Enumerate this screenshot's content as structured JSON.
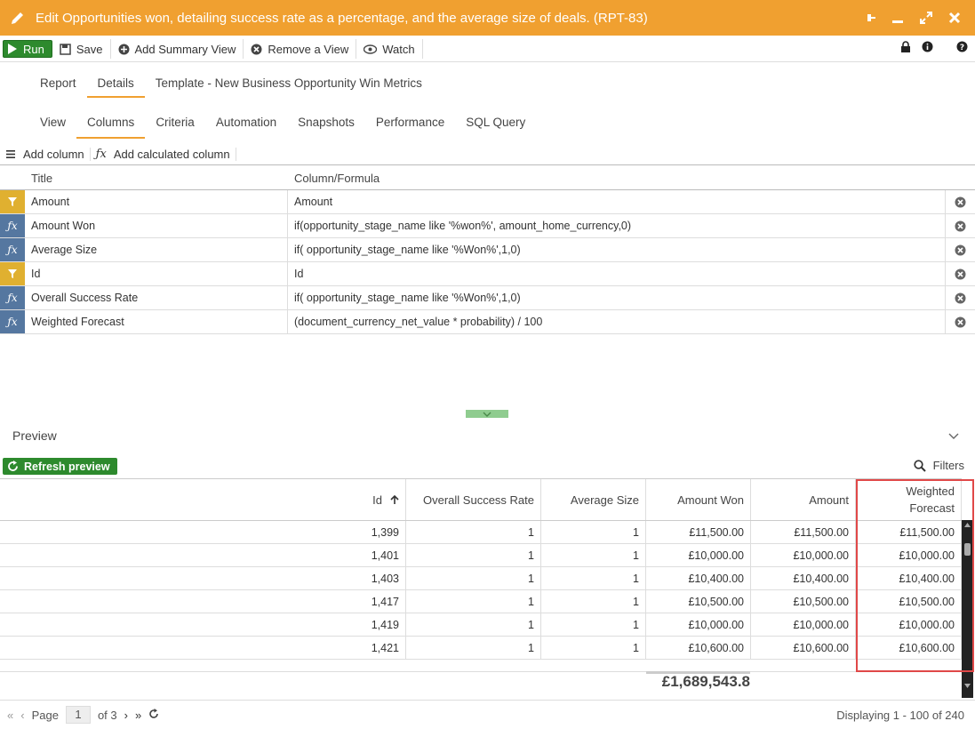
{
  "window": {
    "title": "Edit Opportunities won, detailing success rate as a percentage, and the average size of deals. (RPT-83)"
  },
  "toolbar": {
    "run": "Run",
    "save": "Save",
    "add_summary_view": "Add Summary View",
    "remove_view": "Remove a View",
    "watch": "Watch"
  },
  "tabs_top": [
    {
      "label": "Report"
    },
    {
      "label": "Details"
    },
    {
      "label": "Template - New Business Opportunity Win Metrics"
    }
  ],
  "tabs_sub": [
    {
      "label": "View"
    },
    {
      "label": "Columns"
    },
    {
      "label": "Criteria"
    },
    {
      "label": "Automation"
    },
    {
      "label": "Snapshots"
    },
    {
      "label": "Performance"
    },
    {
      "label": "SQL Query"
    }
  ],
  "column_actions": {
    "add_column": "Add column",
    "add_calculated": "Add calculated column"
  },
  "columns_grid": {
    "header_title": "Title",
    "header_formula": "Column/Formula",
    "rows": [
      {
        "type": "filter",
        "title": "Amount",
        "formula": "Amount"
      },
      {
        "type": "fx",
        "title": "Amount Won",
        "formula": "if(opportunity_stage_name like '%won%', amount_home_currency,0)"
      },
      {
        "type": "fx",
        "title": "Average Size",
        "formula": "if( opportunity_stage_name like '%Won%',1,0)"
      },
      {
        "type": "filter",
        "title": "Id",
        "formula": "Id"
      },
      {
        "type": "fx",
        "title": "Overall Success Rate",
        "formula": "if( opportunity_stage_name like '%Won%',1,0)"
      },
      {
        "type": "fx",
        "title": "Weighted Forecast",
        "formula": "(document_currency_net_value * probability) / 100"
      }
    ]
  },
  "preview": {
    "title": "Preview",
    "refresh": "Refresh preview",
    "filters": "Filters",
    "headers": [
      "Id",
      "Overall Success Rate",
      "Average Size",
      "Amount Won",
      "Amount",
      "Weighted",
      "Forecast"
    ],
    "rows": [
      [
        "1,399",
        "1",
        "1",
        "£11,500.00",
        "£11,500.00",
        "£11,500.00"
      ],
      [
        "1,401",
        "1",
        "1",
        "£10,000.00",
        "£10,000.00",
        "£10,000.00"
      ],
      [
        "1,403",
        "1",
        "1",
        "£10,400.00",
        "£10,400.00",
        "£10,400.00"
      ],
      [
        "1,417",
        "1",
        "1",
        "£10,500.00",
        "£10,500.00",
        "£10,500.00"
      ],
      [
        "1,419",
        "1",
        "1",
        "£10,000.00",
        "£10,000.00",
        "£10,000.00"
      ],
      [
        "1,421",
        "1",
        "1",
        "£10,600.00",
        "£10,600.00",
        "£10,600.00"
      ]
    ],
    "total": "£1,689,543.8"
  },
  "footer": {
    "page_label": "Page",
    "page_value": "1",
    "of_label": "of 3",
    "displaying": "Displaying 1 - 100 of 240"
  },
  "colors": {
    "accent": "#f0a030",
    "run_green": "#2d8a2d",
    "highlight_red": "#e04848"
  }
}
